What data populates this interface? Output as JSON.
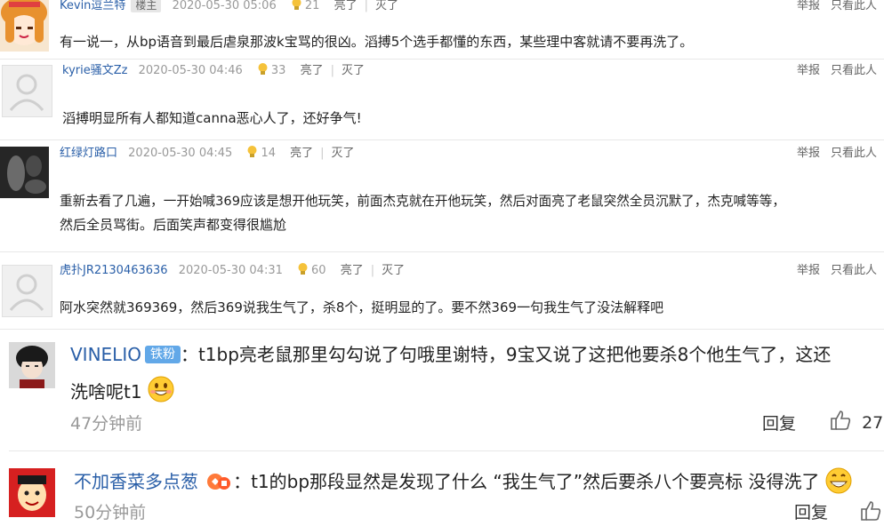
{
  "comments": [
    {
      "user": "Kevin逗兰特",
      "badge": "楼主",
      "time": "2020-05-30 05:06",
      "likes": "21",
      "like_label": "亮了",
      "dislike_label": "灭了",
      "report_label": "举报",
      "only_label": "只看此人",
      "text": "有一说一，从bp语音到最后虐泉那波k宝骂的很凶。滔搏5个选手都懂的东西，某些理中客就请不要再洗了。"
    },
    {
      "user": "kyrie骚文Zz",
      "time": "2020-05-30 04:46",
      "likes": "33",
      "like_label": "亮了",
      "dislike_label": "灭了",
      "report_label": "举报",
      "only_label": "只看此人",
      "text": "滔搏明显所有人都知道canna恶心人了，还好争气!"
    },
    {
      "user": "红绿灯路口",
      "time": "2020-05-30 04:45",
      "likes": "14",
      "like_label": "亮了",
      "dislike_label": "灭了",
      "report_label": "举报",
      "only_label": "只看此人",
      "text_line1": "重新去看了几遍，一开始喊369应该是想开他玩笑，前面杰克就在开他玩笑，然后对面亮了老鼠突然全员沉默了，杰克喊等等，",
      "text_line2": "然后全员骂街。后面笑声都变得很尴尬"
    },
    {
      "user": "虎扑JR2130463636",
      "time": "2020-05-30 04:31",
      "likes": "60",
      "like_label": "亮了",
      "dislike_label": "灭了",
      "report_label": "举报",
      "only_label": "只看此人",
      "text": "阿水突然就369369，然后369说我生气了，杀8个，挺明显的了。要不然369一句我生气了没法解释吧"
    }
  ],
  "weibo_comments": [
    {
      "user": "VINELIO",
      "badge": "铁粉",
      "text_line1": "：t1bp亮老鼠那里勾勾说了句哦里谢特，9宝又说了这把他要杀8个他生气了，这还",
      "text_line2": "洗啥呢t1",
      "time": "47分钟前",
      "reply_label": "回复",
      "likes": "27"
    },
    {
      "user": "不加香菜多点葱",
      "text_line1": "：t1的bp那段显然是发现了什么 “我生气了”然后要杀八个要亮标 没得洗了",
      "time": "50分钟前",
      "reply_label": "回复"
    }
  ],
  "colors": {
    "link": "#2a5fa8",
    "muted": "#999999",
    "fan_badge": "#62a8e8"
  }
}
